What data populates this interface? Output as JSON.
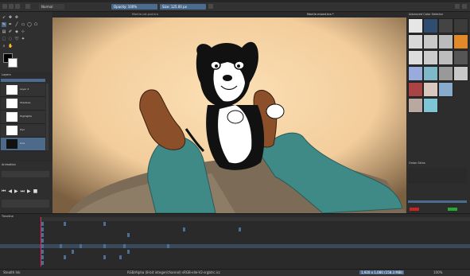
{
  "menubar": {
    "items": [
      "File",
      "Edit",
      "View",
      "Image",
      "Layer",
      "Select",
      "Filter",
      "Tools",
      "Settings",
      "Window",
      "Help"
    ]
  },
  "tool_options": {
    "blend_mode": "Normal",
    "opacity": "Opacity: 100%",
    "size": "Size: 125.00 px"
  },
  "canvas_tabs": [
    "Mantle-cat-psd.kra",
    "Mantle-mixed.kra *"
  ],
  "dockers": {
    "layers_title": "Layers",
    "brush_presets_title": "Brush Presets",
    "animation_title": "Animation",
    "timeline_title": "Timeline",
    "advanced_color": "Advanced Color Selector",
    "onion_skins": "Onion Skins"
  },
  "layers": [
    {
      "name": "Layer 4"
    },
    {
      "name": "Shadows"
    },
    {
      "name": "Highlights"
    },
    {
      "name": "Hair"
    },
    {
      "name": "Line"
    },
    {
      "name": "Background"
    }
  ],
  "status": {
    "brush": "Stealth Ink",
    "color": "RGB/Alpha (8-bit integer/channel)  sRGB-elle-V2-srgbtrc.icc",
    "dimensions": "1,920 x 1,080 (158.3 MiB)",
    "zoom": "100%"
  },
  "colors": {
    "accent": "#4d6a8a",
    "canvas_bg": "#f7d3a5",
    "pants": "#3f8a87",
    "couch": "#7a6a55",
    "skin": "#8b4f2a"
  }
}
